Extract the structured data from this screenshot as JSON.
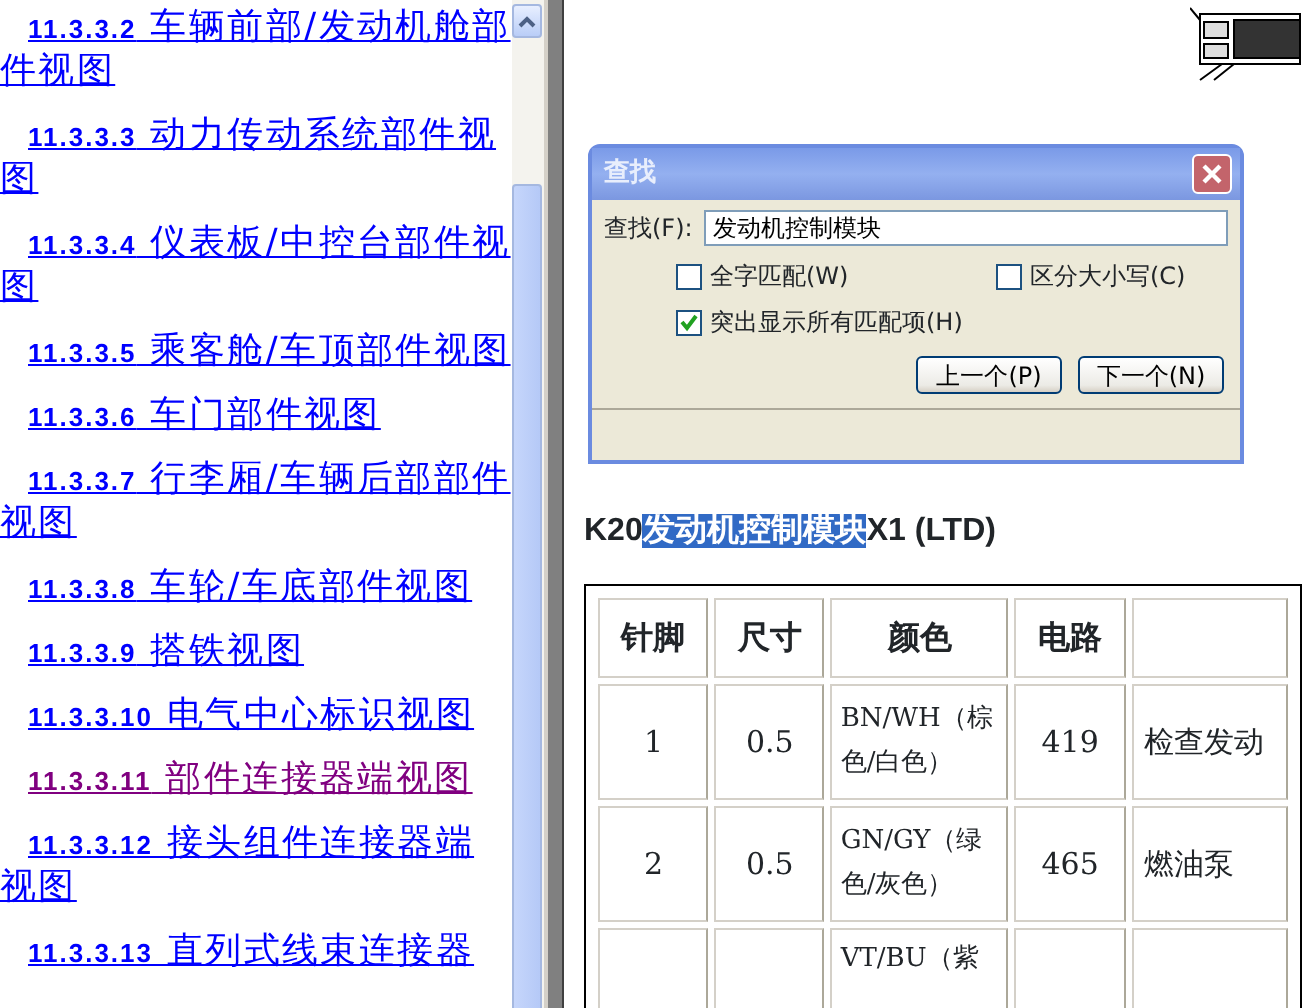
{
  "toc": [
    {
      "number": "11.3.3.2",
      "title": "车辆前部/发动机舱部件视图",
      "visited": false
    },
    {
      "number": "11.3.3.3",
      "title": "动力传动系统部件视图",
      "visited": false
    },
    {
      "number": "11.3.3.4",
      "title": "仪表板/中控台部件视图",
      "visited": false
    },
    {
      "number": "11.3.3.5",
      "title": "乘客舱/车顶部件视图",
      "visited": false
    },
    {
      "number": "11.3.3.6",
      "title": "车门部件视图",
      "visited": false
    },
    {
      "number": "11.3.3.7",
      "title": "行李厢/车辆后部部件视图",
      "visited": false
    },
    {
      "number": "11.3.3.8",
      "title": "车轮/车底部件视图",
      "visited": false
    },
    {
      "number": "11.3.3.9",
      "title": "搭铁视图",
      "visited": false
    },
    {
      "number": "11.3.3.10",
      "title": "电气中心标识视图",
      "visited": false
    },
    {
      "number": "11.3.3.11",
      "title": "部件连接器端视图",
      "visited": true
    },
    {
      "number": "11.3.3.12",
      "title": "接头组件连接器端视图",
      "visited": false
    },
    {
      "number": "11.3.3.13",
      "title": "直列式线束连接器",
      "visited": false
    }
  ],
  "find_dialog": {
    "title": "查找",
    "find_label": "查找(F):",
    "find_value": "发动机控制模块",
    "options": [
      {
        "label": "全字匹配(W)",
        "checked": false
      },
      {
        "label": "区分大小写(C)",
        "checked": false
      },
      {
        "label": "突出显示所有匹配项(H)",
        "checked": true
      }
    ],
    "buttons": [
      "上一个(P)",
      "下一个(N)"
    ]
  },
  "heading": {
    "before": "K20",
    "highlight": "发动机控制模块",
    "after": "X1 (LTD)"
  },
  "table": {
    "columns": [
      "针脚",
      "尺寸",
      "颜色",
      "电路",
      ""
    ],
    "rows": [
      [
        "1",
        "0.5",
        "BN/WH（棕色/白色）",
        "419",
        "检查发动"
      ],
      [
        "2",
        "0.5",
        "GN/GY（绿色/灰色）",
        "465",
        "燃油泵"
      ],
      [
        "",
        "",
        "VT/BU（紫",
        "",
        ""
      ]
    ]
  }
}
